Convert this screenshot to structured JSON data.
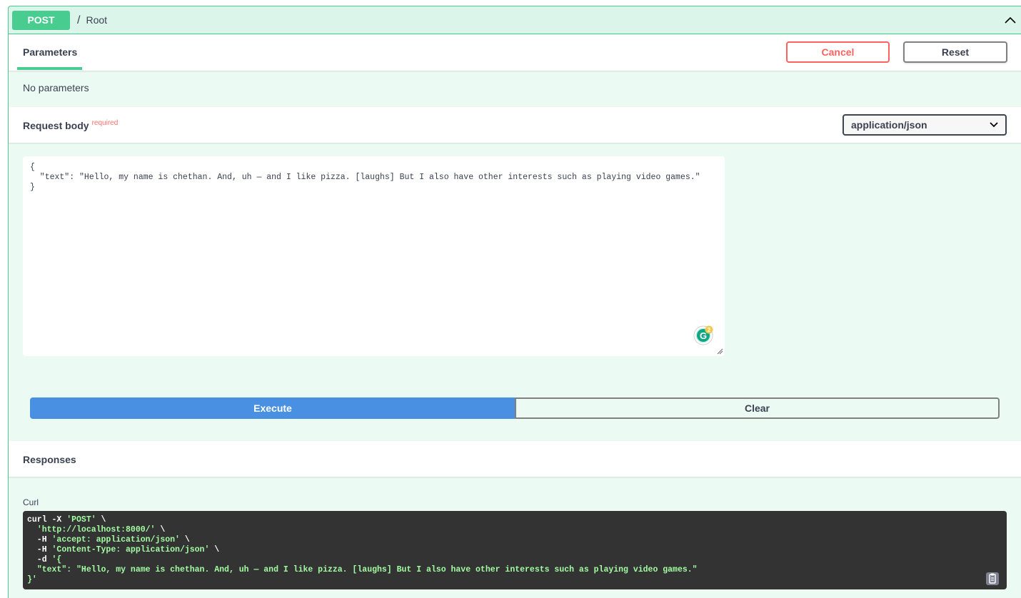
{
  "summary": {
    "method": "POST",
    "separator": "/",
    "path": "Root"
  },
  "parameters": {
    "tab_label": "Parameters",
    "cancel_label": "Cancel",
    "reset_label": "Reset",
    "no_params_text": "No parameters"
  },
  "request_body": {
    "title": "Request body",
    "required_label": "required",
    "content_type": "application/json",
    "value": "{\n  \"text\": \"Hello, my name is chethan. And, uh — and I like pizza. [laughs] But I also have other interests such as playing video games.\"\n}",
    "grammarly_badge": "2"
  },
  "actions": {
    "execute_label": "Execute",
    "clear_label": "Clear"
  },
  "responses": {
    "title": "Responses",
    "curl_label": "Curl",
    "curl_cmd": "curl -X ",
    "curl_method": "'POST'",
    "curl_cont": " \\",
    "curl_url": "'http://localhost:8000/'",
    "curl_h1": "'accept: application/json'",
    "curl_h2": "'Content-Type: application/json'",
    "curl_d_open": "'{",
    "curl_body": "\"text\": \"Hello, my name is chethan. And, uh — and I like pizza. [laughs] But I also have other interests such as playing video games.\"",
    "curl_close": "}'"
  },
  "colors": {
    "post_green": "#49cc90",
    "execute_blue": "#4990e2",
    "cancel_red": "#ff6060"
  }
}
